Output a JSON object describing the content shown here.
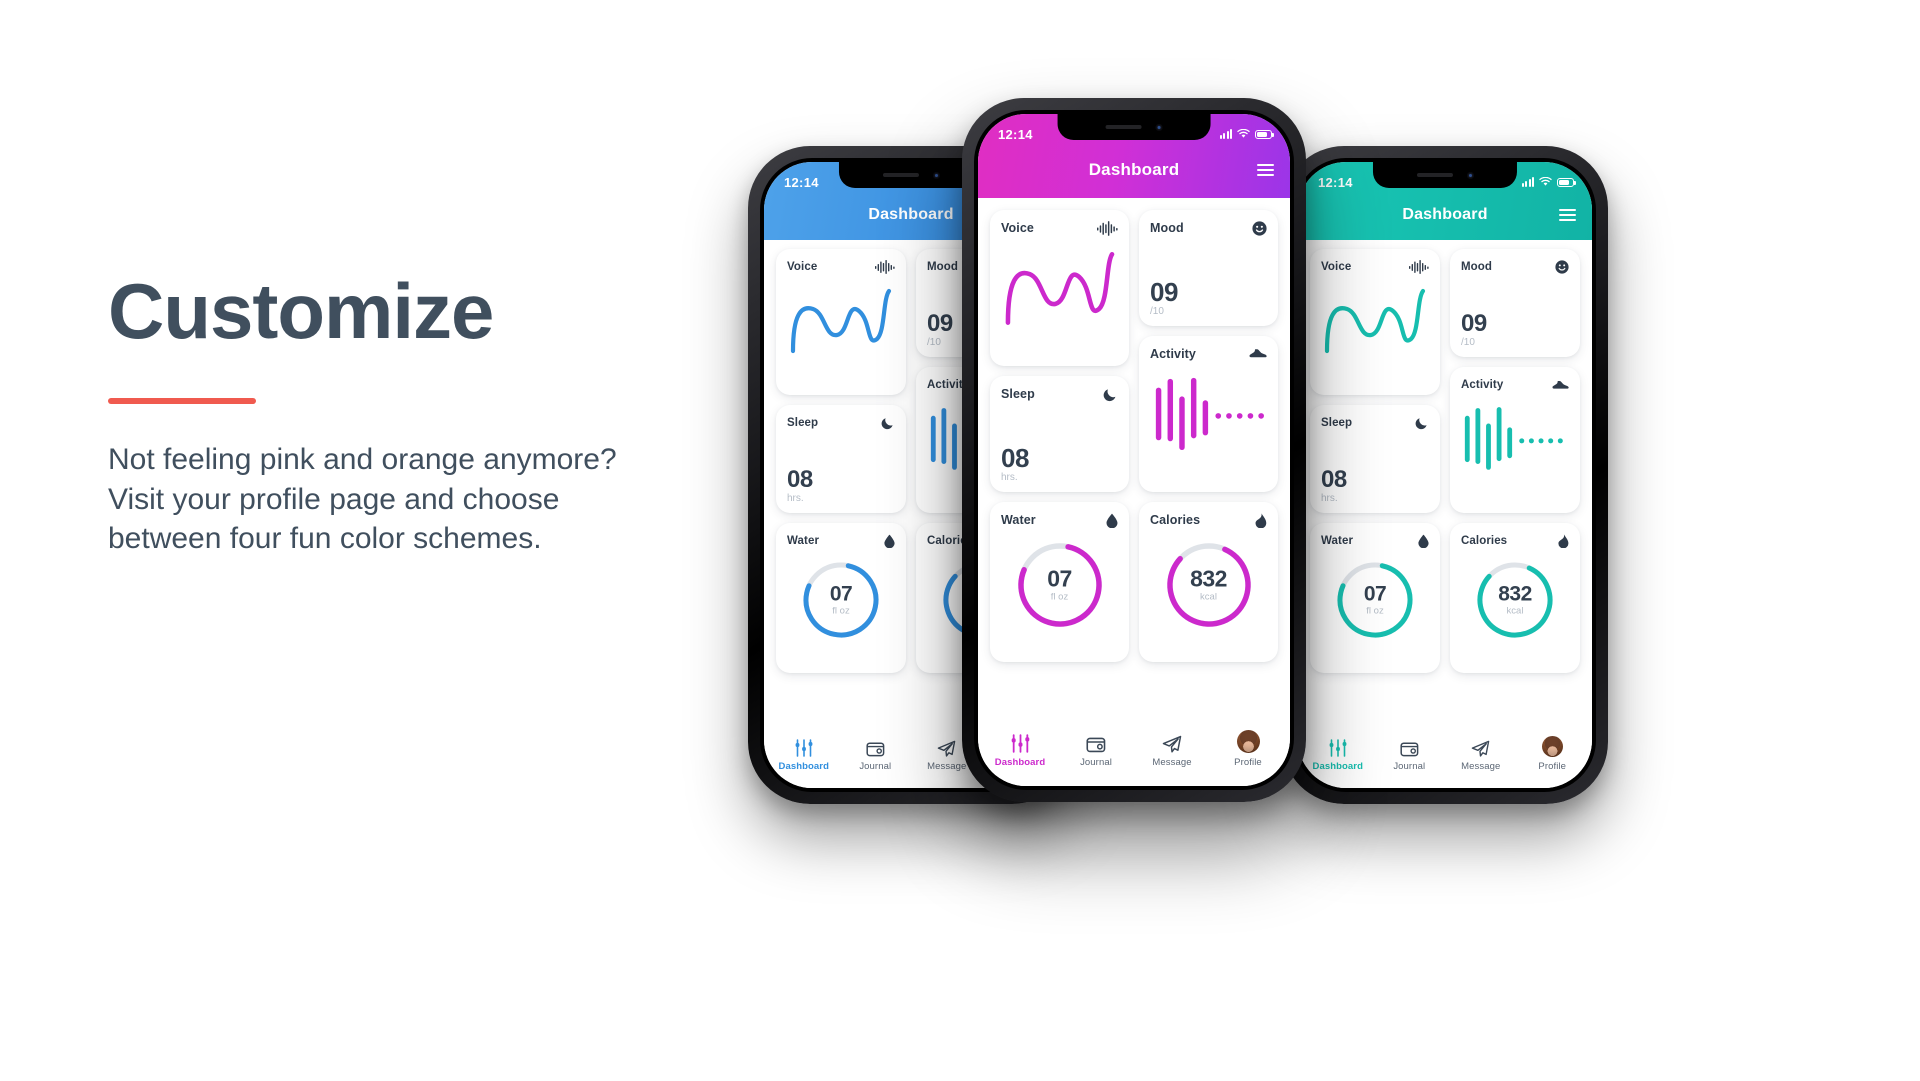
{
  "page": {
    "headline": "Customize",
    "body_lines": [
      "Not feeling pink and orange anymore?",
      "Visit your profile page and choose",
      "between four fun color schemes."
    ],
    "accent_rule_color": "#f05a4f",
    "text_color": "#404f5e"
  },
  "phones": {
    "left": {
      "theme_name": "blue",
      "accent": "#2f8fe0",
      "header_from": "#4da2ec",
      "header_to": "#2f86dd"
    },
    "center": {
      "theme_name": "magenta-purple",
      "accent": "#cc29cc",
      "header_from": "#e22fc4",
      "header_to": "#9b35e8"
    },
    "right": {
      "theme_name": "teal",
      "accent": "#14bfaf",
      "header_from": "#16c8b5",
      "header_to": "#0fb9a9"
    }
  },
  "app": {
    "status": {
      "time": "12:14",
      "signal_icon": "signal-bars-icon",
      "wifi_icon": "wifi-icon",
      "battery_icon": "battery-icon"
    },
    "header": {
      "title": "Dashboard",
      "menu_icon": "hamburger-menu-icon"
    },
    "cards": {
      "voice": {
        "title": "Voice",
        "icon": "waveform-icon",
        "chart_type": "line"
      },
      "mood": {
        "title": "Mood",
        "icon": "smiley-face-icon",
        "value": "09",
        "unit": "/10"
      },
      "sleep": {
        "title": "Sleep",
        "icon": "moon-icon",
        "value": "08",
        "unit": "hrs."
      },
      "activity": {
        "title": "Activity",
        "icon": "running-shoe-icon",
        "chart_type": "bar"
      },
      "water": {
        "title": "Water",
        "icon": "water-drop-icon",
        "value": "07",
        "unit": "fl oz",
        "progress_percent": 78
      },
      "calories": {
        "title": "Calories",
        "icon": "flame-icon",
        "value": "832",
        "unit": "kcal",
        "progress_percent": 80
      }
    },
    "tabs": [
      {
        "label": "Dashboard",
        "icon": "sliders-icon",
        "active": true
      },
      {
        "label": "Journal",
        "icon": "wallet-icon",
        "active": false
      },
      {
        "label": "Message",
        "icon": "paper-plane-icon",
        "active": false
      },
      {
        "label": "Profile",
        "icon": "avatar-icon",
        "active": false
      }
    ]
  },
  "chart_data": {
    "type": "line",
    "title": "Voice",
    "x": [
      0,
      1,
      2,
      3,
      4,
      5,
      6,
      7,
      8
    ],
    "y": [
      6,
      62,
      72,
      40,
      66,
      44,
      14,
      40,
      86
    ],
    "ylim": [
      0,
      100
    ],
    "xlabel": "",
    "ylabel": "",
    "grid": false,
    "legend": "none",
    "activity_bars": {
      "type": "bar",
      "values": [
        62,
        80,
        52,
        84,
        44
      ],
      "trailing_dots": 5
    }
  }
}
